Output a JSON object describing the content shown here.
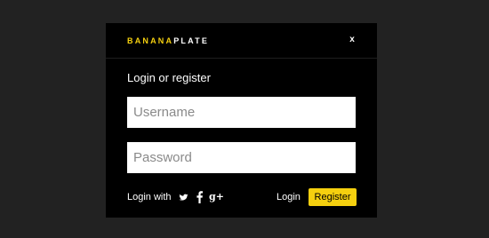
{
  "brand": {
    "part_yellow": "BANANA",
    "part_white": "PLATE",
    "accent_color": "#f5d00f"
  },
  "modal": {
    "close_label": "x",
    "title": "Login or register",
    "username_placeholder": "Username",
    "password_placeholder": "Password"
  },
  "footer": {
    "login_with_label": "Login with",
    "social_icons": [
      "twitter-icon",
      "facebook-icon",
      "google-plus-icon"
    ],
    "google_plus_glyph": "g+",
    "login_label": "Login",
    "register_label": "Register"
  }
}
